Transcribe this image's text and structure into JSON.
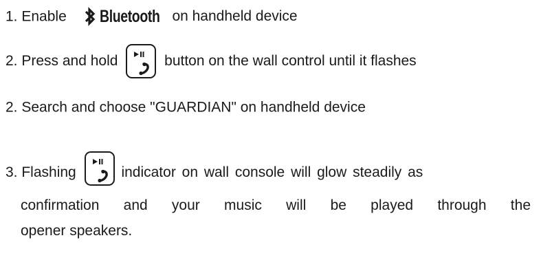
{
  "steps": [
    {
      "number": "1.",
      "before": "Enable",
      "logo_icon": "bluetooth-icon",
      "logo_text": "Bluetooth",
      "after": "on handheld device"
    },
    {
      "number": "2.",
      "before": "Press and hold",
      "button_icon": "play-pause-phone-button-icon",
      "after": "button on the wall control until it flashes"
    },
    {
      "number": "2.",
      "text": "Search and choose \"GUARDIAN\" on handheld device"
    },
    {
      "number": "3.",
      "before": "Flashing",
      "button_icon": "play-pause-phone-button-icon",
      "after_line1": "indicator on wall console will glow steadily as",
      "line2": "confirmation and your music will be played through the",
      "line3": "opener speakers."
    }
  ]
}
